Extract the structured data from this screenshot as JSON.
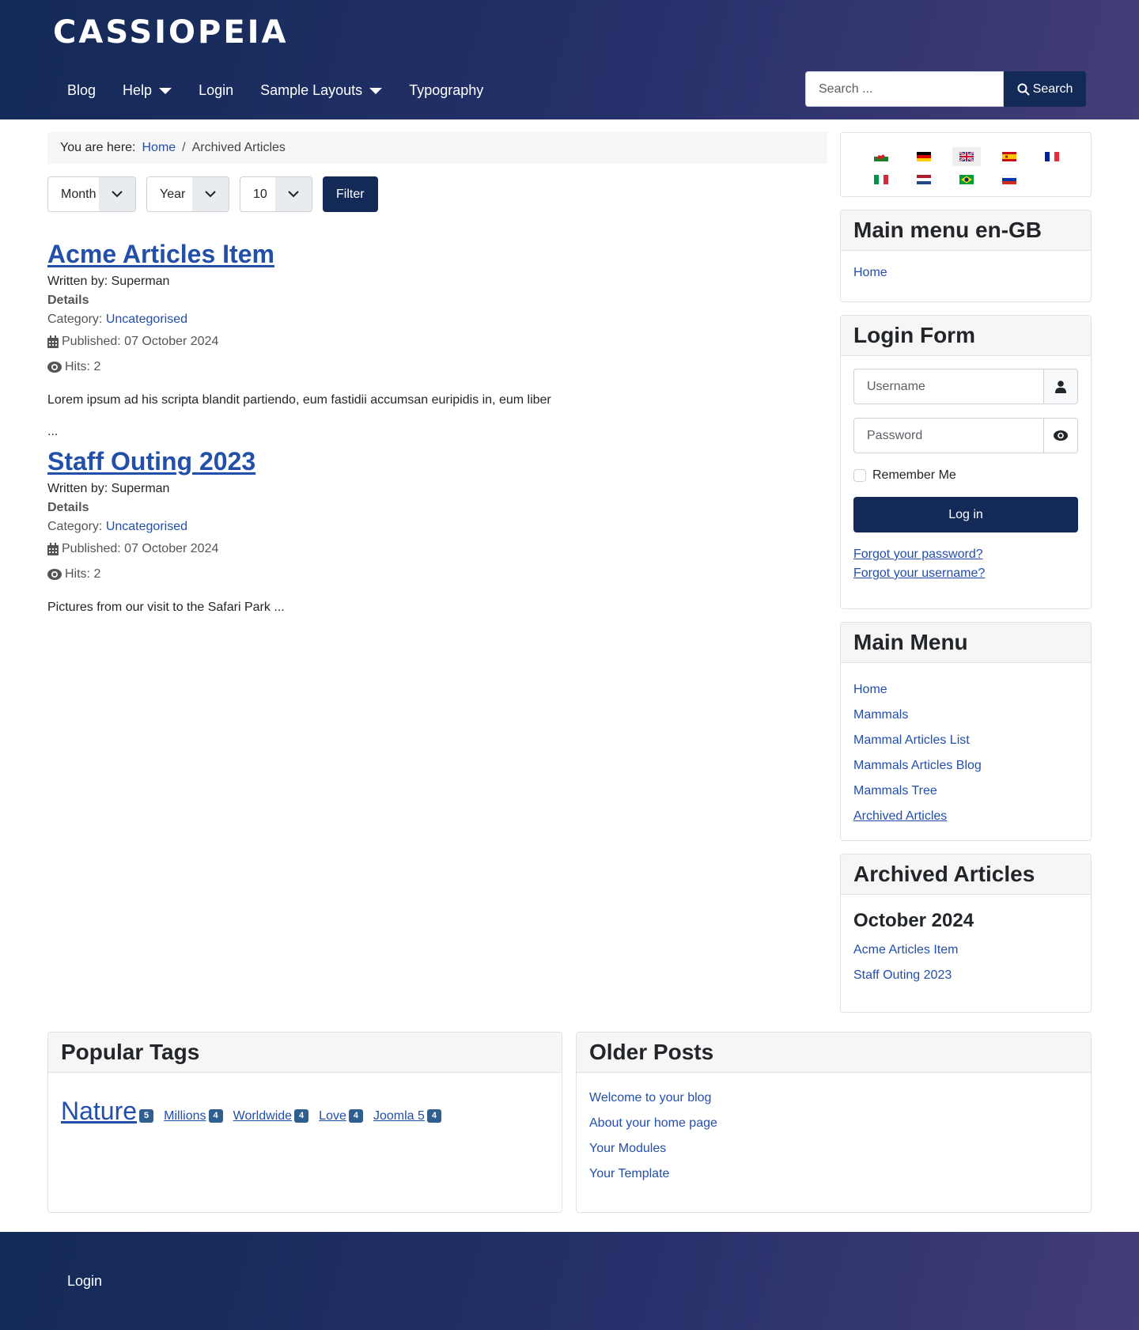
{
  "header": {
    "logo": "CASSIOPEIA",
    "nav": [
      {
        "label": "Blog",
        "dropdown": false
      },
      {
        "label": "Help",
        "dropdown": true
      },
      {
        "label": "Login",
        "dropdown": false
      },
      {
        "label": "Sample Layouts",
        "dropdown": true
      },
      {
        "label": "Typography",
        "dropdown": false
      }
    ],
    "search": {
      "placeholder": "Search ...",
      "value": "",
      "button_label": "Search",
      "icon": "search-icon"
    }
  },
  "breadcrumb": {
    "label": "You are here:",
    "items": [
      {
        "label": "Home",
        "link": true
      },
      {
        "label": "Archived Articles",
        "link": false
      }
    ],
    "separator": "/"
  },
  "filters": {
    "month": {
      "selected": "Month"
    },
    "year": {
      "selected": "Year"
    },
    "limit": {
      "selected": "10"
    },
    "button_label": "Filter"
  },
  "articles": [
    {
      "title": "Acme Articles Item",
      "author": "Written by: Superman",
      "details_label": "Details",
      "category_label": "Category:",
      "category": "Uncategorised",
      "published": "Published: 07 October 2024",
      "hits": "Hits: 2",
      "intro": "Lorem ipsum ad his scripta blandit partiendo, eum fastidii accumsan euripidis in, eum liber",
      "ellipsis": "..."
    },
    {
      "title": "Staff Outing 2023",
      "author": "Written by: Superman",
      "details_label": "Details",
      "category_label": "Category:",
      "category": "Uncategorised",
      "published": "Published: 07 October 2024",
      "hits": "Hits: 2",
      "intro": "Pictures from our visit to the Safari Park ..."
    }
  ],
  "sidebar": {
    "languages": [
      {
        "code": "cy",
        "name": "Welsh",
        "active": false
      },
      {
        "code": "de",
        "name": "German",
        "active": false
      },
      {
        "code": "en-GB",
        "name": "English (UK)",
        "active": true
      },
      {
        "code": "es",
        "name": "Spanish",
        "active": false
      },
      {
        "code": "fr",
        "name": "French",
        "active": false
      },
      {
        "code": "it",
        "name": "Italian",
        "active": false
      },
      {
        "code": "nl",
        "name": "Dutch",
        "active": false
      },
      {
        "code": "pt-BR",
        "name": "Portuguese (Brazil)",
        "active": false
      },
      {
        "code": "ru",
        "name": "Russian",
        "active": false
      }
    ],
    "main_menu_en_gb": {
      "title": "Main menu en-GB",
      "items": [
        {
          "label": "Home"
        }
      ]
    },
    "login_form": {
      "title": "Login Form",
      "username_placeholder": "Username",
      "password_placeholder": "Password",
      "remember_label": "Remember Me",
      "remember_checked": false,
      "login_button": "Log in",
      "forgot_password": "Forgot your password?",
      "forgot_username": "Forgot your username?"
    },
    "main_menu": {
      "title": "Main Menu",
      "items": [
        {
          "label": "Home",
          "active": false
        },
        {
          "label": "Mammals",
          "active": false
        },
        {
          "label": "Mammal Articles List",
          "active": false
        },
        {
          "label": "Mammals Articles Blog",
          "active": false
        },
        {
          "label": "Mammals Tree",
          "active": false
        },
        {
          "label": "Archived Articles",
          "active": true
        }
      ]
    },
    "archived": {
      "title": "Archived Articles",
      "month": "October 2024",
      "items": [
        {
          "label": "Acme Articles Item"
        },
        {
          "label": "Staff Outing 2023"
        }
      ]
    }
  },
  "bottom": {
    "popular_tags": {
      "title": "Popular Tags",
      "tags": [
        {
          "label": "Nature",
          "count": "5"
        },
        {
          "label": "Millions",
          "count": "4"
        },
        {
          "label": "Worldwide",
          "count": "4"
        },
        {
          "label": "Love",
          "count": "4"
        },
        {
          "label": "Joomla 5",
          "count": "4"
        }
      ]
    },
    "older_posts": {
      "title": "Older Posts",
      "items": [
        {
          "label": "Welcome to your blog"
        },
        {
          "label": "About your home page"
        },
        {
          "label": "Your Modules"
        },
        {
          "label": "Your Template"
        }
      ]
    }
  },
  "footer": {
    "links": [
      {
        "label": "Login"
      }
    ]
  },
  "colors": {
    "brand": "#132a57",
    "link": "#224faa",
    "badge": "#2f5f8e"
  }
}
